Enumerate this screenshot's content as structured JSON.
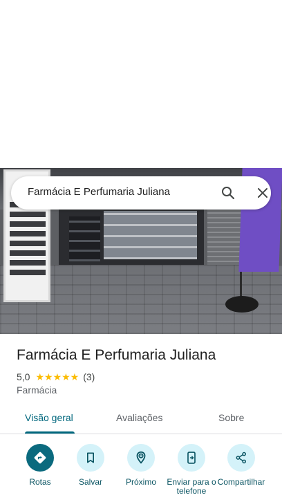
{
  "search": {
    "query": "Farmácia E Perfumaria Juliana",
    "search_icon": "search-icon",
    "clear_icon": "close-icon"
  },
  "place": {
    "name": "Farmácia E Perfumaria Juliana",
    "rating": "5,0",
    "stars_display": "★★★★★",
    "stars_value": 5,
    "review_count": "(3)",
    "category": "Farmácia"
  },
  "tabs": [
    {
      "label": "Visão geral",
      "active": true
    },
    {
      "label": "Avaliações",
      "active": false
    },
    {
      "label": "Sobre",
      "active": false
    }
  ],
  "actions": [
    {
      "label": "Rotas",
      "icon": "directions-icon"
    },
    {
      "label": "Salvar",
      "icon": "bookmark-icon"
    },
    {
      "label": "Próximo",
      "icon": "nearby-icon"
    },
    {
      "label": "Enviar para o telefone",
      "icon": "send-to-phone-icon"
    },
    {
      "label": "Compartilhar",
      "icon": "share-icon"
    }
  ],
  "colors": {
    "accent": "#00677d",
    "primary_action": "#0b6a7e",
    "action_bg": "#d4f2f9",
    "star": "#fbbc04"
  }
}
